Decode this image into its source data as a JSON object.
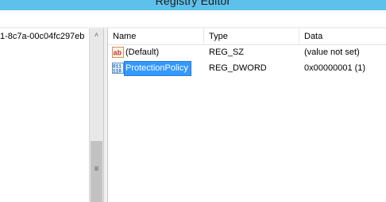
{
  "window": {
    "title": "Registry Editor"
  },
  "tree": {
    "visible_key_fragment": "1-8c7a-00c04fc297eb",
    "scroll_up_glyph": "˄",
    "thumb_grip_glyph": "≡"
  },
  "list": {
    "columns": {
      "name": "Name",
      "type": "Type",
      "data": "Data"
    },
    "rows": [
      {
        "icon": "string-value-icon",
        "name": "(Default)",
        "type": "REG_SZ",
        "data": "(value not set)"
      },
      {
        "icon": "binary-value-icon",
        "name": "ProtectionPolicy",
        "type": "REG_DWORD",
        "data": "0x00000001 (1)",
        "selected": true
      }
    ]
  },
  "colors": {
    "titlebar": "#5ec1ec",
    "selection": "#3399ff",
    "string_icon": "#c0392b",
    "binary_icon": "#1e6bb8"
  }
}
